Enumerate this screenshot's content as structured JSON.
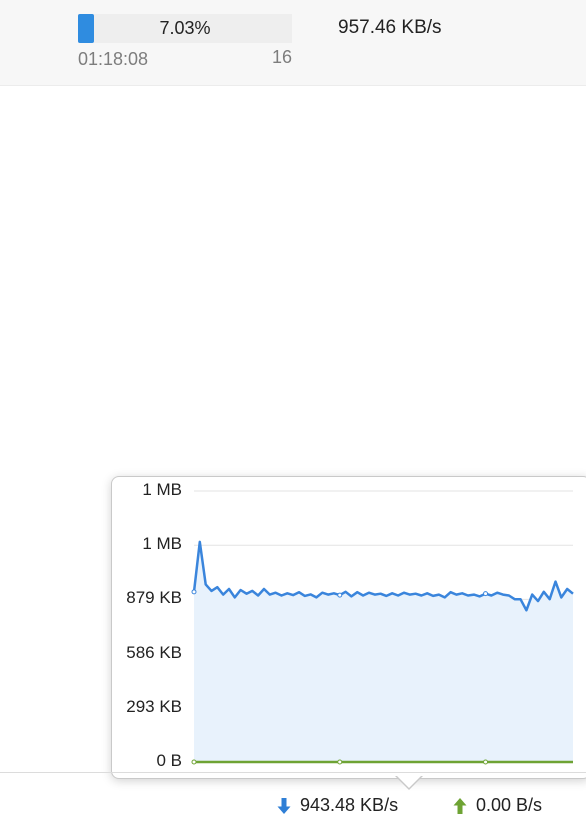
{
  "task": {
    "progress_text": "7.03%",
    "progress_value": 0.0703,
    "elapsed": "01:18:08",
    "connections": "16",
    "speed": "957.46 KB/s"
  },
  "statusbar": {
    "download_speed": "943.48 KB/s",
    "upload_speed": "0.00 B/s",
    "download_icon": "arrow-down-icon",
    "upload_icon": "arrow-up-icon",
    "download_color": "#2f7fd6",
    "upload_color": "#6ea334"
  },
  "chart_data": {
    "type": "area",
    "y_tick_labels": [
      "1 MB",
      "1 MB",
      "879 KB",
      "586 KB",
      "293 KB",
      "0 B"
    ],
    "y_tick_values_kb": [
      1465,
      1172,
      879,
      586,
      293,
      0
    ],
    "ylim_kb": [
      0,
      1465
    ],
    "grid": true,
    "series": [
      {
        "color": "#3a85dc",
        "fill": "#e8f2fc",
        "values_kb": [
          920,
          1190,
          960,
          925,
          945,
          905,
          935,
          890,
          930,
          910,
          925,
          900,
          935,
          905,
          915,
          900,
          912,
          902,
          918,
          898,
          906,
          890,
          915,
          905,
          912,
          902,
          920,
          895,
          918,
          900,
          915,
          905,
          910,
          898,
          912,
          900,
          915,
          905,
          910,
          900,
          912,
          898,
          905,
          890,
          918,
          905,
          912,
          900,
          905,
          895,
          910,
          900,
          915,
          905,
          900,
          880,
          880,
          820,
          905,
          870,
          920,
          880,
          975,
          890,
          935,
          910
        ]
      },
      {
        "color": "#6ea334",
        "values_kb": [
          0,
          0,
          0,
          0,
          0,
          0,
          0,
          0,
          0,
          0,
          0,
          0,
          0,
          0,
          0,
          0,
          0,
          0,
          0,
          0,
          0,
          0,
          0,
          0,
          0,
          0,
          0,
          0,
          0,
          0,
          0,
          0,
          0,
          0,
          0,
          0,
          0,
          0,
          0,
          0,
          0,
          0,
          0,
          0,
          0,
          0,
          0,
          0,
          0,
          0,
          0,
          0,
          0,
          0,
          0,
          0,
          0,
          0,
          0,
          0,
          0,
          0,
          0,
          0,
          0,
          0
        ]
      }
    ]
  }
}
